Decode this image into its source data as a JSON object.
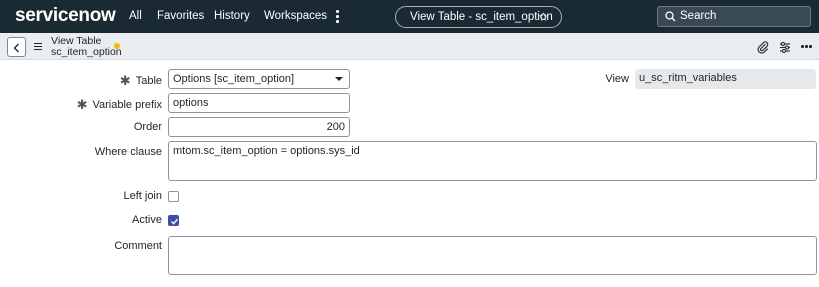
{
  "nav": {
    "logo": "servicenow",
    "items": [
      "All",
      "Favorites",
      "History",
      "Workspaces"
    ],
    "page_title": "View Table - sc_item_option",
    "search_label": "Search"
  },
  "header": {
    "record_type": "View Table",
    "record_name": "sc_item_option"
  },
  "form": {
    "table": {
      "label": "Table",
      "value": "Options [sc_item_option]"
    },
    "view": {
      "label": "View",
      "value": "u_sc_ritm_variables"
    },
    "variable_prefix": {
      "label": "Variable prefix",
      "value": "options"
    },
    "order": {
      "label": "Order",
      "value": "200"
    },
    "where_clause": {
      "label": "Where clause",
      "value": "mtom.sc_item_option = options.sys_id"
    },
    "left_join": {
      "label": "Left join",
      "checked": false
    },
    "active": {
      "label": "Active",
      "checked": true
    },
    "comment": {
      "label": "Comment",
      "value": ""
    }
  },
  "colors": {
    "topbar": "#1a2a33",
    "header_bg": "#e9edf0",
    "checkbox_on": "#3d4ea8",
    "modified_dot": "#f5b90f"
  }
}
